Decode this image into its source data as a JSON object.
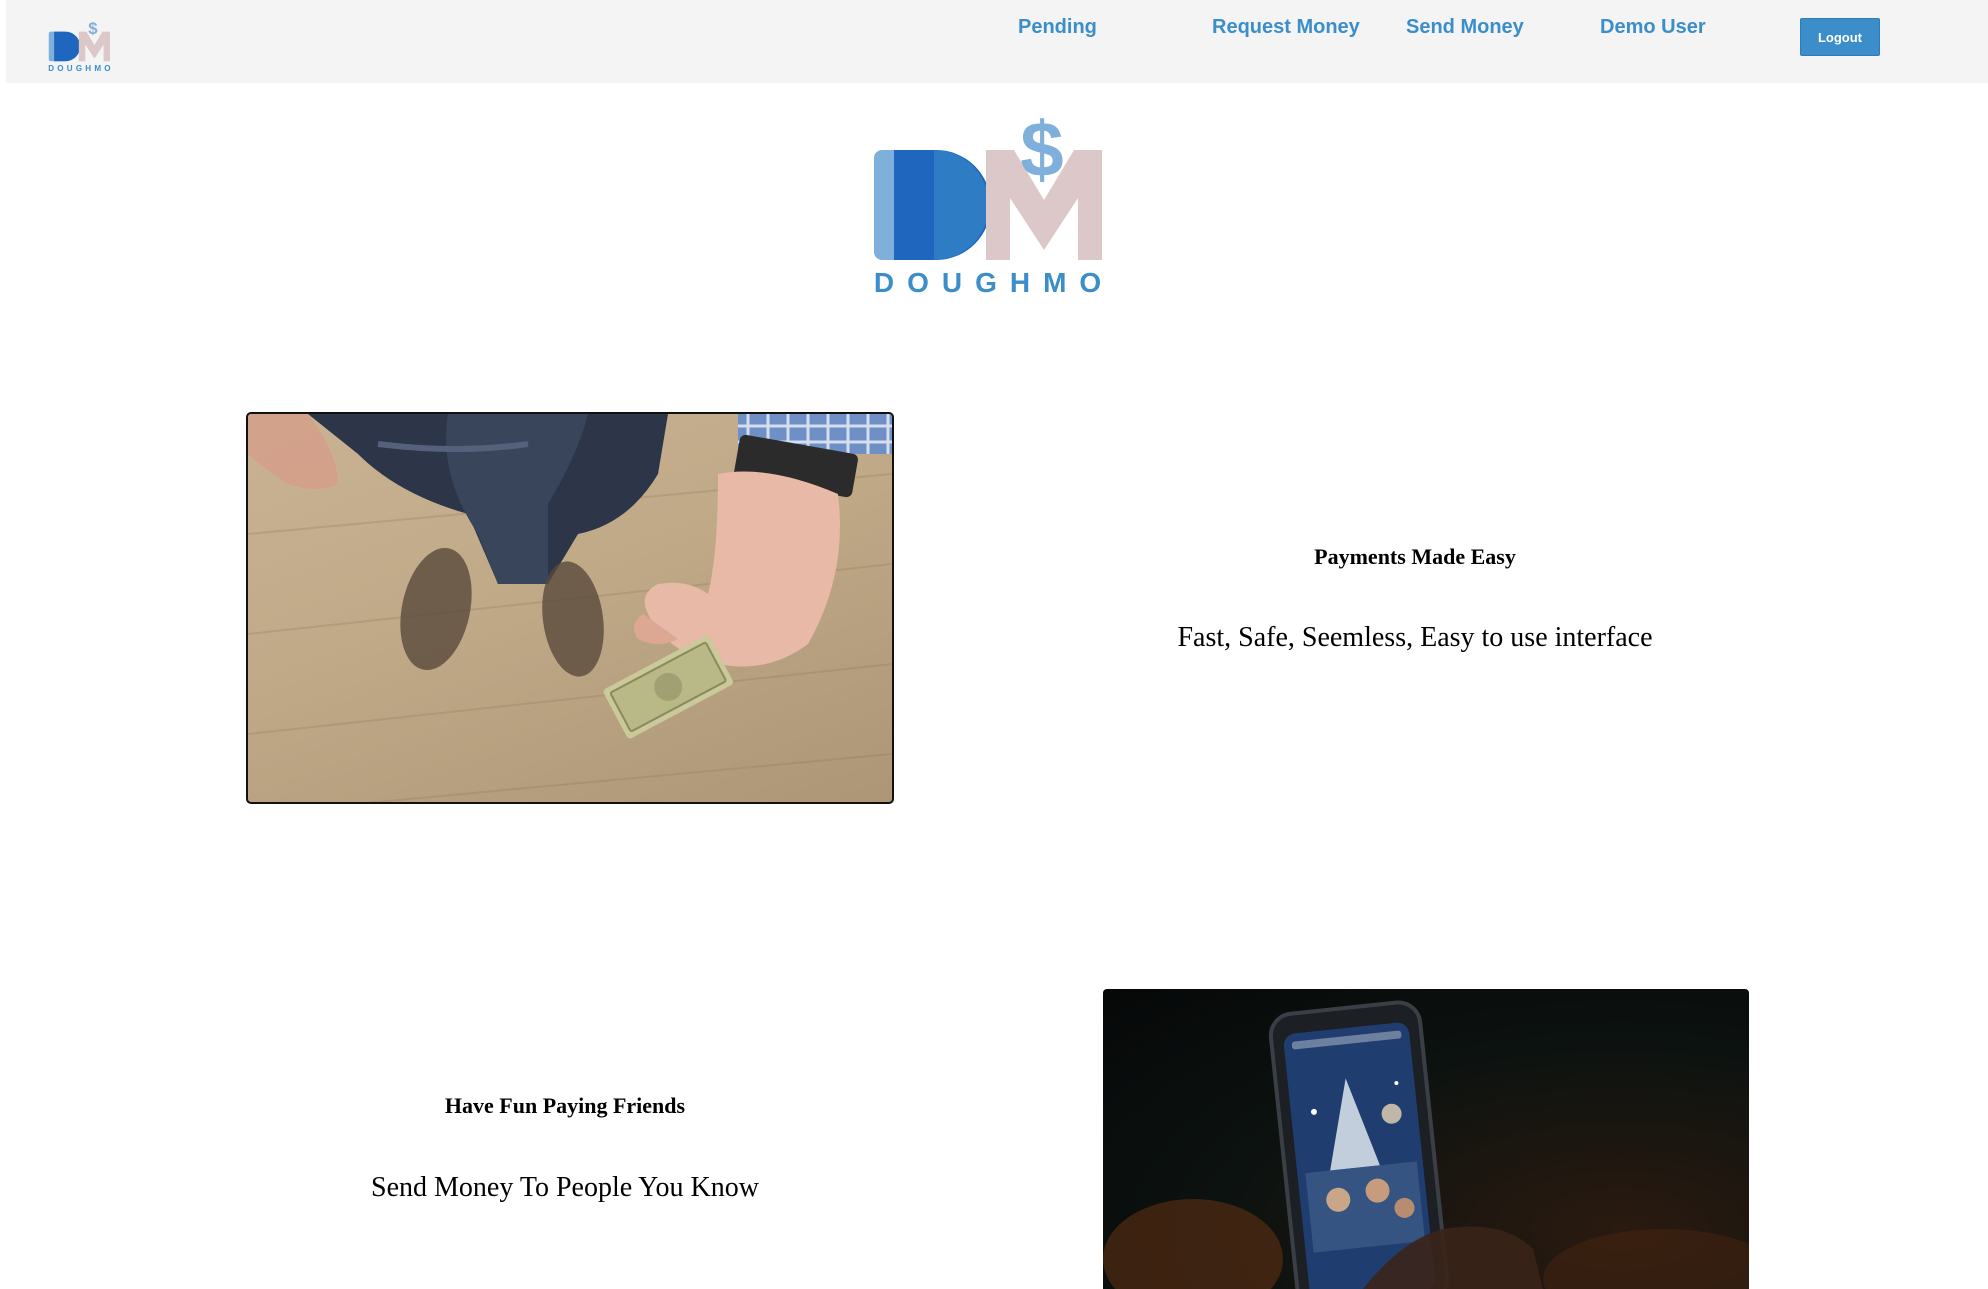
{
  "navbar": {
    "logo_alt": "Doughmo logo",
    "links": [
      "Pending",
      "Request Money",
      "Send Money",
      "Demo User"
    ],
    "logout_label": "Logout"
  },
  "hero": {
    "brand_monogram": "DM",
    "brand_symbol": "$",
    "brand_name": "DOUGHMO"
  },
  "features": [
    {
      "title": "Payments Made Easy",
      "subtitle": "Fast, Safe, Seemless, Easy to use interface",
      "image_alt": "hand-giving-cash-photo"
    },
    {
      "title": "Have Fun Paying Friends",
      "subtitle": "Send Money To People You Know",
      "image_alt": "phone-photo-at-night"
    }
  ],
  "colors": {
    "accent": "#3b8ec9",
    "logo_blue_light": "#7fb0dc",
    "logo_blue_dark": "#1e66be",
    "logo_pink": "#dcc8c8",
    "navbar_bg": "#f4f4f4"
  }
}
